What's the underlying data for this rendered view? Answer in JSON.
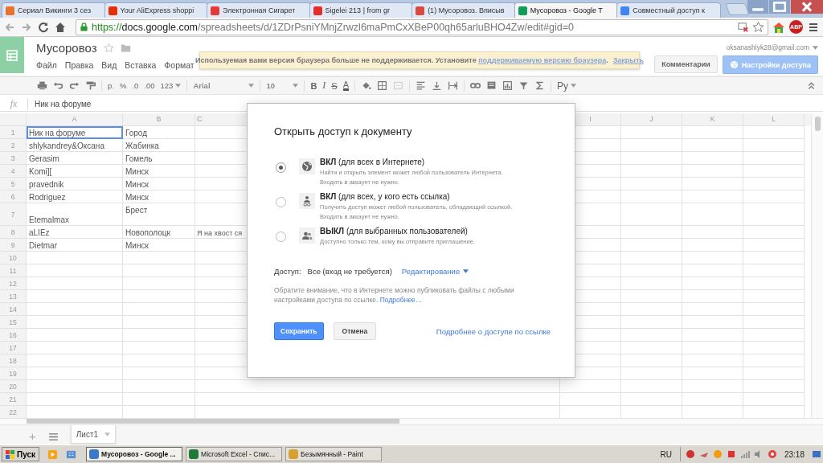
{
  "browser": {
    "tabs": [
      {
        "title": "Сериал Викинги 3 сез",
        "color": "#e8732c",
        "selected": false
      },
      {
        "title": "Your AliExpress shoppi",
        "color": "#e62e04",
        "selected": false
      },
      {
        "title": "Электронная Сигарет",
        "color": "#e53935",
        "selected": false
      },
      {
        "title": "Sigelei 213 | from gr",
        "color": "#e52d27",
        "selected": false
      },
      {
        "title": "(1) Мусоровоз. Вписыв",
        "color": "#d84b3e",
        "selected": false
      },
      {
        "title": "Мусоровоз - Google T",
        "color": "#0f9d58",
        "selected": true
      },
      {
        "title": "Совместный доступ к",
        "color": "#4285f4",
        "selected": false
      }
    ],
    "address": {
      "scheme": "https://",
      "host": "docs.google.com",
      "path": "/spreadsheets/d/1ZDrPsniYMnjZrwzl6maPmCxXBeP00qh65arluBHO4Zw/edit#gid=0"
    },
    "adblock_label": "ABP"
  },
  "docs": {
    "title": "Мусоровоз",
    "menu": [
      "Файл",
      "Правка",
      "Вид",
      "Вставка",
      "Формат"
    ],
    "notice": {
      "text": "Используемая вами версия браузера больше не поддерживается. Установите",
      "link": "поддерживаемую версию браузера",
      "link_suffix": ".",
      "close": "Закрыть"
    },
    "account": "oksanashlyk28@gmail.com",
    "comments_button": "Комментарии",
    "share_button": "Настройки доступа"
  },
  "toolbar": {
    "currency": "р.",
    "percent": "%",
    "decrease_decimals": ".0",
    "increase_decimals": ".00",
    "number_format": "123",
    "font": "Arial",
    "font_size": "10",
    "bold": "B",
    "italic": "I",
    "strike": "S",
    "text_color": "A",
    "input_tools": "Ру"
  },
  "formula_bar": {
    "label": "fx",
    "value": "Ник на форуме"
  },
  "sheet": {
    "columns": [
      "A",
      "B",
      "C",
      "I",
      "J",
      "K",
      "L"
    ],
    "rows": [
      {
        "number": "1",
        "tall": false,
        "cells": [
          {
            "text": "Ник на форуме",
            "selected": true
          },
          {
            "text": "Город",
            "selected": false
          }
        ]
      },
      {
        "number": "2",
        "tall": false,
        "cells": [
          {
            "text": "shlykandrey&Оксана",
            "selected": false
          },
          {
            "text": "Жабинка",
            "selected": false
          }
        ]
      },
      {
        "number": "3",
        "tall": false,
        "cells": [
          {
            "text": "Gerasim",
            "selected": false
          },
          {
            "text": "Гомель",
            "selected": false
          }
        ]
      },
      {
        "number": "4",
        "tall": false,
        "cells": [
          {
            "text": "Komi][",
            "selected": false
          },
          {
            "text": "Минск",
            "selected": false
          }
        ]
      },
      {
        "number": "5",
        "tall": false,
        "cells": [
          {
            "text": "pravednik",
            "selected": false
          },
          {
            "text": "Минск",
            "selected": false
          }
        ]
      },
      {
        "number": "6",
        "tall": false,
        "cells": [
          {
            "text": "Rodriguez",
            "selected": false
          },
          {
            "text": "Минск",
            "selected": false
          }
        ]
      },
      {
        "number": "7",
        "tall": true,
        "cells": [
          {
            "text": "Etemalmax",
            "selected": false
          },
          {
            "text": "Брест",
            "selected": false
          }
        ]
      },
      {
        "number": "8",
        "tall": false,
        "cells": [
          {
            "text": "aLIEz",
            "selected": false
          },
          {
            "text": "Новополоцк",
            "selected": false
          },
          {
            "text": "Я на хвост ся",
            "selected": false
          }
        ]
      },
      {
        "number": "9",
        "tall": false,
        "cells": [
          {
            "text": "Dietmar",
            "selected": false
          },
          {
            "text": "Минск",
            "selected": false
          }
        ]
      },
      {
        "number": "10"
      },
      {
        "number": "11"
      },
      {
        "number": "12"
      },
      {
        "number": "13"
      },
      {
        "number": "14"
      },
      {
        "number": "15"
      },
      {
        "number": "16"
      },
      {
        "number": "17"
      },
      {
        "number": "18"
      },
      {
        "number": "19"
      },
      {
        "number": "20"
      },
      {
        "number": "21"
      },
      {
        "number": "22"
      }
    ],
    "tabs": [
      {
        "label": "Лист1",
        "selected": true
      }
    ],
    "add_sheet": "+"
  },
  "dialog": {
    "title": "Открыть доступ к документу",
    "options": [
      {
        "kind": "public",
        "label": "**ВКЛ** (для всех в Интернете)",
        "description": [
          "Найти и открыть элемент может любой пользователь Интернета.",
          "Входить в аккаунт не нужно."
        ],
        "selected": true
      },
      {
        "kind": "link",
        "label": "**ВКЛ** (для всех, у кого есть ссылка)",
        "description": [
          "Получить доступ может любой пользователь, обладающий ссылкой.",
          "Входить в аккаунт не нужно."
        ],
        "selected": false
      },
      {
        "kind": "private",
        "label": "**ВЫКЛ** (для выбранных пользователей)",
        "description": [
          "Доступно только тем, кому вы отправите приглашение."
        ],
        "selected": false
      }
    ],
    "access_label": "Доступ:",
    "access_value": "Все (вход не требуется)",
    "permission": "Редактирование",
    "note": "Обратите внимание, что в Интернете можно публиковать файлы с любыми настройками доступа по ссылке.",
    "note_link": "Подробнее…",
    "save": "Сохранить",
    "cancel": "Отмена",
    "help_link": "Подробнее о доступе по ссылке"
  },
  "taskbar": {
    "start": "Пуск",
    "tasks": [
      {
        "title": "Мусоровоз - Google ...",
        "color": "#3b78c8",
        "selected": true
      },
      {
        "title": "Microsoft Excel - Спис...",
        "color": "#1f7a3a",
        "selected": false
      },
      {
        "title": "Безымянный - Paint",
        "color": "#d8a030",
        "selected": false
      }
    ],
    "language": "RU",
    "time": "23:18"
  }
}
